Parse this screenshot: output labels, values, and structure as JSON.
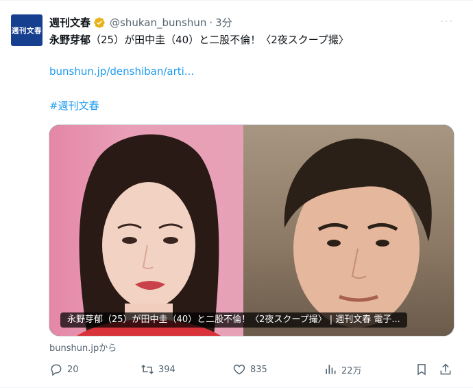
{
  "tweet": {
    "avatar_text": "週刊文春",
    "name": "週刊文春",
    "handle": "@shukan_bunshun",
    "separator": "·",
    "time": "3分",
    "text_bold": "永野芽郁",
    "text_rest": "（25）が田中圭（40）と二股不倫！〈2夜スクープ撮〉",
    "link": "bunshun.jp/denshiban/arti...",
    "hashtag": "#週刊文春",
    "card_caption": "永野芽郁（25）が田中圭（40）と二股不倫！〈2夜スクープ撮〉 | 週刊文春 電子...",
    "source": "bunshun.jpから"
  },
  "actions": {
    "reply_count": "20",
    "retweet_count": "394",
    "like_count": "835",
    "views_count": "22万"
  },
  "colors": {
    "link": "#1d9bf0",
    "muted": "#536471",
    "verified": "#e8b21b",
    "avatar_bg": "#173f8f"
  }
}
